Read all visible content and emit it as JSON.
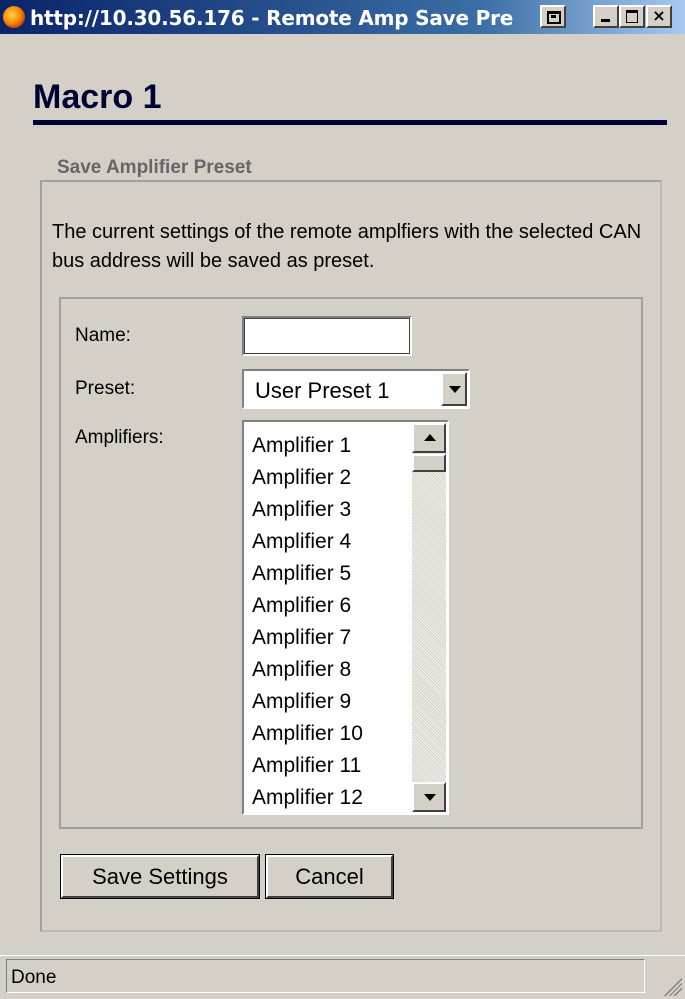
{
  "window": {
    "title": "http://10.30.56.176 - Remote Amp Save Pre"
  },
  "page": {
    "title": "Macro 1",
    "section_legend": "Save Amplifier Preset",
    "description": "The current settings of the remote amplfiers with the selected CAN bus address will be saved as preset."
  },
  "form": {
    "name_label": "Name:",
    "name_value": "",
    "preset_label": "Preset:",
    "preset_value": "User Preset 1",
    "amplifiers_label": "Amplifiers:",
    "amplifiers": [
      "Amplifier 1",
      "Amplifier 2",
      "Amplifier 3",
      "Amplifier 4",
      "Amplifier 5",
      "Amplifier 6",
      "Amplifier 7",
      "Amplifier 8",
      "Amplifier 9",
      "Amplifier 10",
      "Amplifier 11",
      "Amplifier 12"
    ]
  },
  "buttons": {
    "save": "Save Settings",
    "cancel": "Cancel"
  },
  "statusbar": {
    "text": "Done"
  }
}
